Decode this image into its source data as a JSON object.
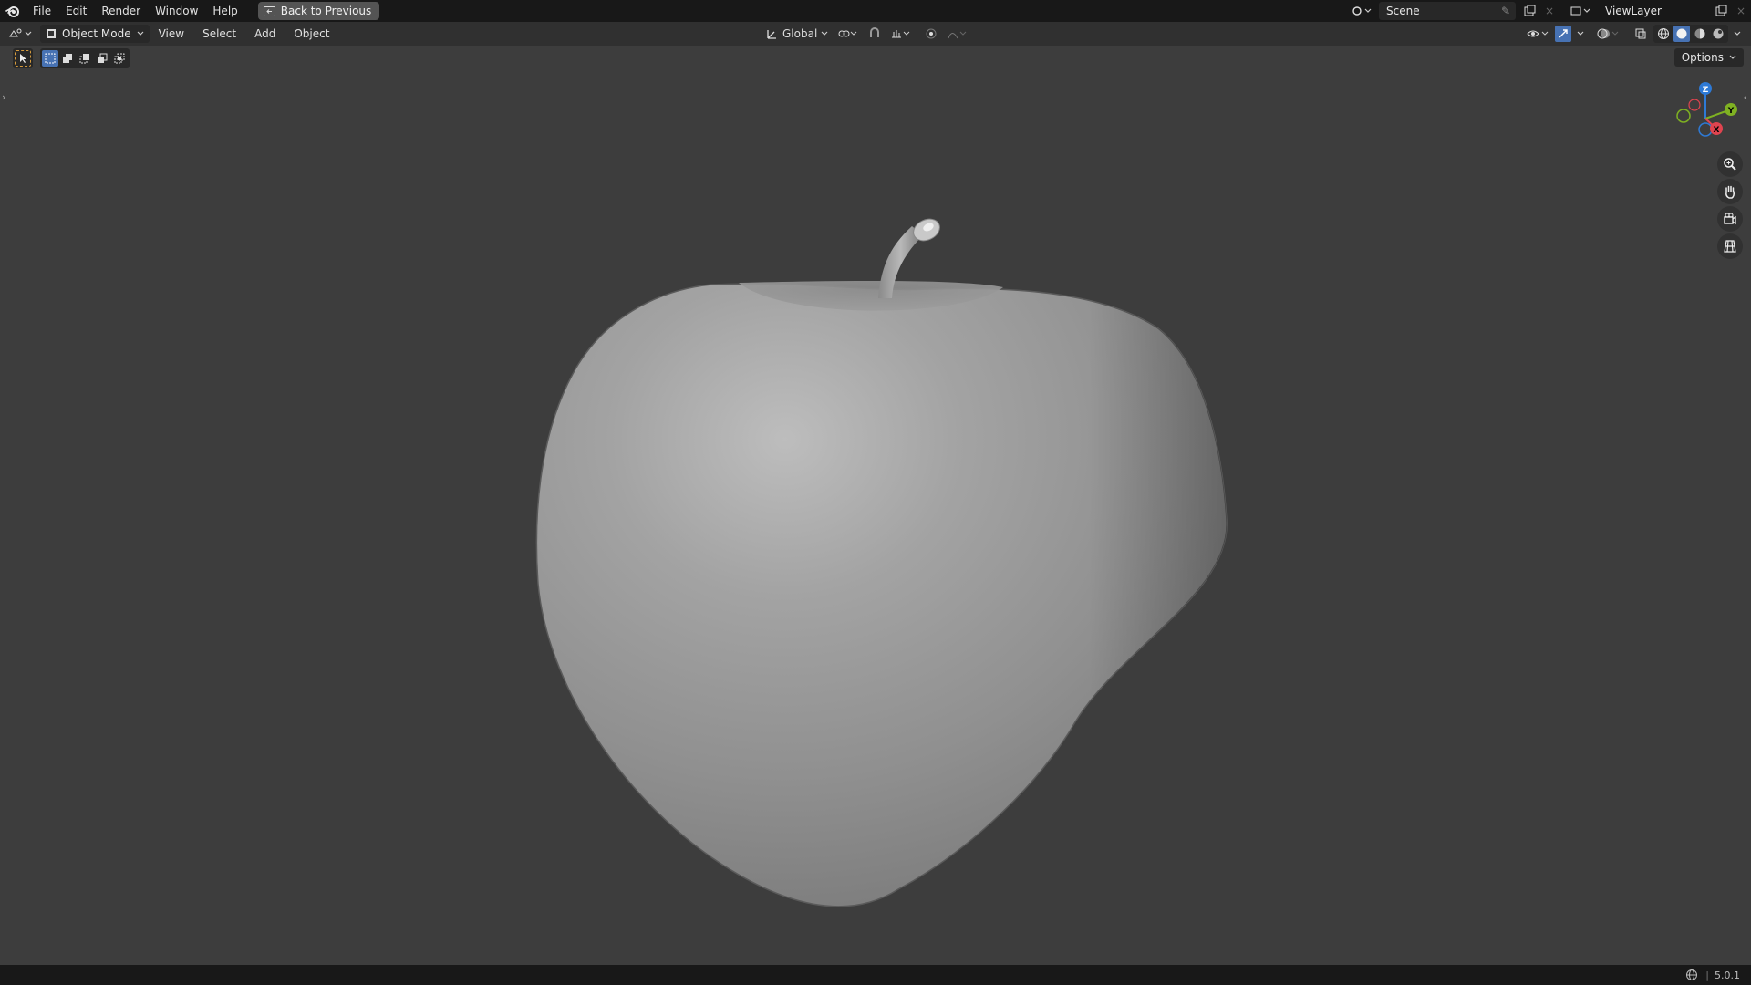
{
  "menu": [
    "File",
    "Edit",
    "Render",
    "Window",
    "Help"
  ],
  "back_button": "Back to Previous",
  "scene": "Scene",
  "view_layer": "ViewLayer",
  "header": {
    "mode": "Object Mode",
    "items": [
      "View",
      "Select",
      "Add",
      "Object"
    ],
    "orientation": "Global"
  },
  "options_label": "Options",
  "status": {
    "version": "5.0.1"
  },
  "gizmo": {
    "z": "Z",
    "y": "Y",
    "x": "X"
  },
  "colors": {
    "accent": "#4772b3",
    "viewport_bg": "#3d3d3d",
    "axis_x": "#e0444f",
    "axis_y": "#7fb122",
    "axis_z": "#2e7ad6"
  }
}
